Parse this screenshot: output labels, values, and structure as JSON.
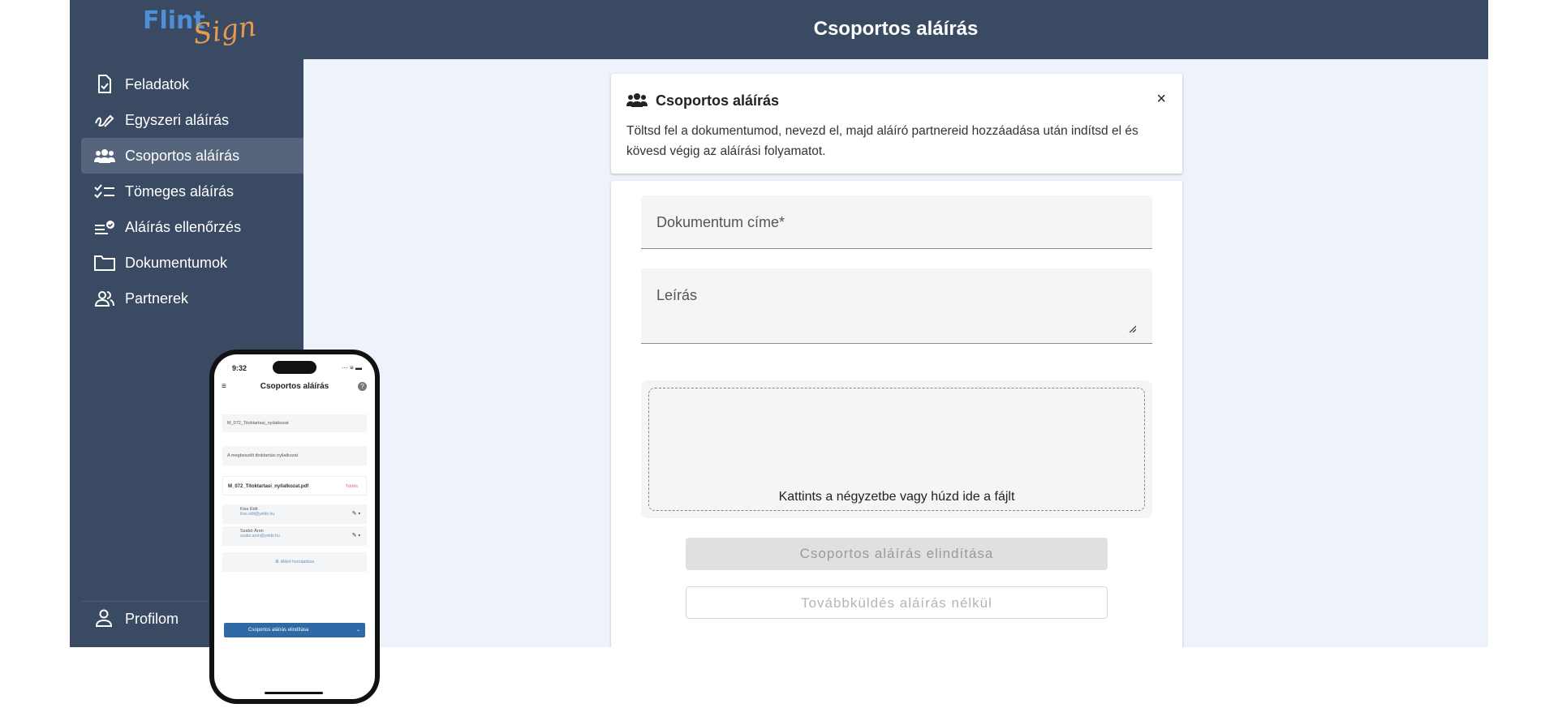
{
  "app": {
    "logo_part1": "Flint",
    "logo_part2": "Sign",
    "title": "Csoportos aláírás"
  },
  "sidebar": {
    "items": [
      {
        "label": "Feladatok",
        "icon": "task-doc-icon"
      },
      {
        "label": "Egyszeri aláírás",
        "icon": "signature-icon"
      },
      {
        "label": "Csoportos aláírás",
        "icon": "group-icon",
        "active": true
      },
      {
        "label": "Tömeges aláírás",
        "icon": "checklist-icon"
      },
      {
        "label": "Aláírás ellenőrzés",
        "icon": "verify-icon"
      },
      {
        "label": "Dokumentumok",
        "icon": "folder-icon"
      },
      {
        "label": "Partnerek",
        "icon": "partners-icon"
      }
    ],
    "profile_label": "Profilom"
  },
  "info": {
    "title": "Csoportos aláírás",
    "close": "×",
    "text": "Töltsd fel a dokumentumod, nevezd el, majd aláíró partnereid hozzáadása után indítsd el és kövesd végig az aláírási folyamatot."
  },
  "form": {
    "title_label": "Dokumentum címe*",
    "description_label": "Leírás",
    "drop_text": "Kattints a négyzetbe vagy húzd ide a fájlt",
    "start_button": "Csoportos aláírás elindítása",
    "forward_button": "Továbbküldés aláírás nélkül"
  },
  "phone": {
    "time": "9:32",
    "status": "··· ≡ ▬",
    "title": "Csoportos aláírás",
    "doc_title": "M_072_Titoktartasi_nyilatkozat",
    "doc_desc": "A megbeszélt titoktartási nyilatkozat",
    "file_name": "M_072_Titoktartasi_nyilatkozat.pdf",
    "file_delete": "Törlés",
    "signers": [
      {
        "name": "Kiss Edit",
        "email": "kiss.edit@yeldo.hu"
      },
      {
        "name": "Szabó Áron",
        "email": "szabo.aron@yeldo.hu"
      }
    ],
    "add_signer": "Aláíró hozzáadása",
    "cta": "Csoportos aláírás elindítása"
  },
  "colors": {
    "sidebar_bg": "#3b4a63",
    "active_bg": "#56657c",
    "content_bg": "#eef3fb",
    "logo_blue": "#4f8fd8",
    "logo_orange": "#e59a52",
    "phone_cta": "#2f6aa6"
  }
}
